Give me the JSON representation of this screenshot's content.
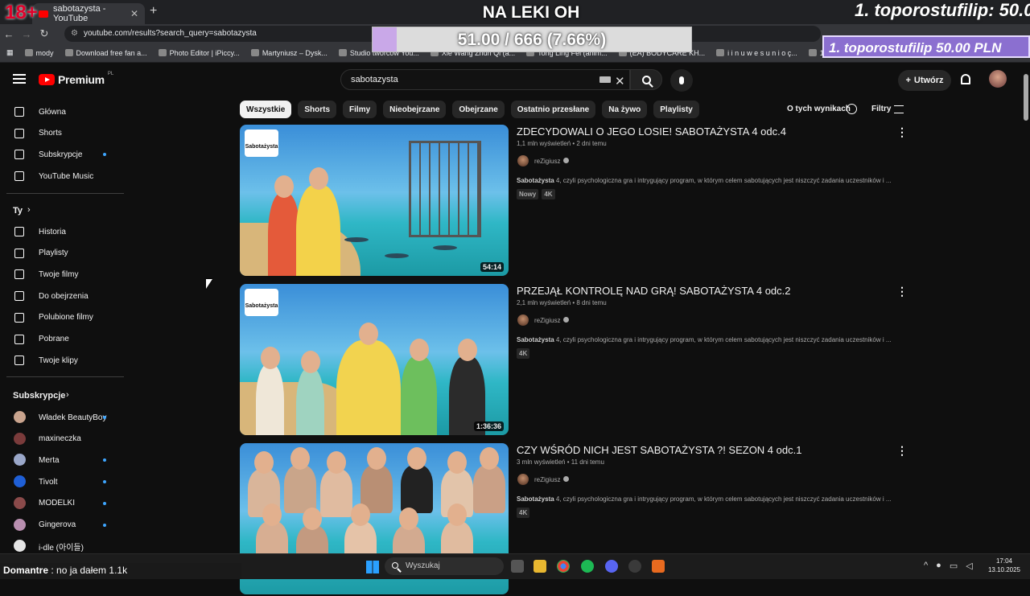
{
  "browser": {
    "tab_title": "sabotazysta - YouTube",
    "url": "youtube.com/results?search_query=sabotazysta",
    "bookmarks": [
      "mody",
      "Download free fan a...",
      "Photo Editor | iPiccy...",
      "Martyniusz – Dysk...",
      "Studio twórców You...",
      "Xie Wang Zhuri Qi (a...",
      "Tong Ling Fei (anim...",
      "(EA) BODYCARE KH...",
      "i i n u w e s u n i o ç...",
      "100000340123_Wol..."
    ]
  },
  "overlay": {
    "age": "18+",
    "title": "NA LEKI OH",
    "progress_text": "51.00 / 666 (7.66%)",
    "progress_fraction": 0.0766,
    "top_donor": "1. toporostufilip: 50.0",
    "top_donor_box": "1. toporostufilip 50.00 PLN",
    "chat_user": "Domantre",
    "chat_text": " : no ja dałem 1.1k"
  },
  "header": {
    "brand": "Premium",
    "region": "PL",
    "search_value": "sabotazysta",
    "create_label": "Utwórz"
  },
  "sidebar": {
    "main": [
      {
        "label": "Główna",
        "icon": "home-icon"
      },
      {
        "label": "Shorts",
        "icon": "shorts-icon"
      },
      {
        "label": "Subskrypcje",
        "icon": "subscriptions-icon",
        "dot": true
      },
      {
        "label": "YouTube Music",
        "icon": "music-icon"
      }
    ],
    "you_header": "Ty",
    "you": [
      {
        "label": "Historia",
        "icon": "history-icon"
      },
      {
        "label": "Playlisty",
        "icon": "playlists-icon"
      },
      {
        "label": "Twoje filmy",
        "icon": "your-videos-icon"
      },
      {
        "label": "Do obejrzenia",
        "icon": "watch-later-icon"
      },
      {
        "label": "Polubione filmy",
        "icon": "liked-icon"
      },
      {
        "label": "Pobrane",
        "icon": "download-icon"
      },
      {
        "label": "Twoje klipy",
        "icon": "clips-icon"
      }
    ],
    "subs_header": "Subskrypcje",
    "subs": [
      {
        "label": "Władek BeautyBoy",
        "color": "#c9a48e"
      },
      {
        "label": "maxineczka",
        "color": "#7a3b3b"
      },
      {
        "label": "Merta",
        "color": "#9aa7c9"
      },
      {
        "label": "Tivolt",
        "color": "#1f5fd6"
      },
      {
        "label": "MODELKI",
        "color": "#8a4a4a"
      },
      {
        "label": "Gingerova",
        "color": "#b98fb0"
      },
      {
        "label": "i-dle (아이들)",
        "color": "#e5e5e5"
      }
    ]
  },
  "chips": [
    "Wszystkie",
    "Shorts",
    "Filmy",
    "Nieobejrzane",
    "Obejrzane",
    "Ostatnio przesłane",
    "Na żywo",
    "Playlisty"
  ],
  "about_results": "O tych wynikach",
  "filters_label": "Filtry",
  "results": [
    {
      "title": "ZDECYDOWALI O JEGO LOSIE! SABOTAŻYSTA 4 odc.4",
      "meta": "1,1 mln wyświetleń • 2 dni temu",
      "channel": "reZigiusz",
      "desc_bold": "Sabotażysta",
      "desc": " 4, czyli psychologiczna gra i intrygujący program, w którym celem sabotujących jest niszczyć zadania uczestników i ...",
      "badges": [
        "Nowy",
        "4K"
      ],
      "duration": "54:14",
      "logo": "Sabotażysta"
    },
    {
      "title": "PRZEJĄŁ KONTROLĘ NAD GRĄ! SABOTAŻYSTA 4 odc.2",
      "meta": "2,1 mln wyświetleń • 8 dni temu",
      "channel": "reZigiusz",
      "desc_bold": "Sabotażysta",
      "desc": " 4, czyli psychologiczna gra i intrygujący program, w którym celem sabotujących jest niszczyć zadania uczestników i ...",
      "badges": [
        "4K"
      ],
      "duration": "1:36:36",
      "logo": "Sabotażysta"
    },
    {
      "title": "CZY WŚRÓD NICH JEST SABOTAŻYSTA ?! SEZON 4 odc.1",
      "meta": "3 mln wyświetleń • 11 dni temu",
      "channel": "reZigiusz",
      "desc_bold": "Sabotażysta",
      "desc": " 4, czyli psychologiczna gra i intrygujący program, w którym celem sabotujących jest niszczyć zadania uczestników i ...",
      "badges": [
        "4K"
      ],
      "duration": "",
      "logo": ""
    }
  ],
  "taskbar": {
    "search_placeholder": "Wyszukaj",
    "time": "17:04",
    "date": "13.10.2025"
  }
}
